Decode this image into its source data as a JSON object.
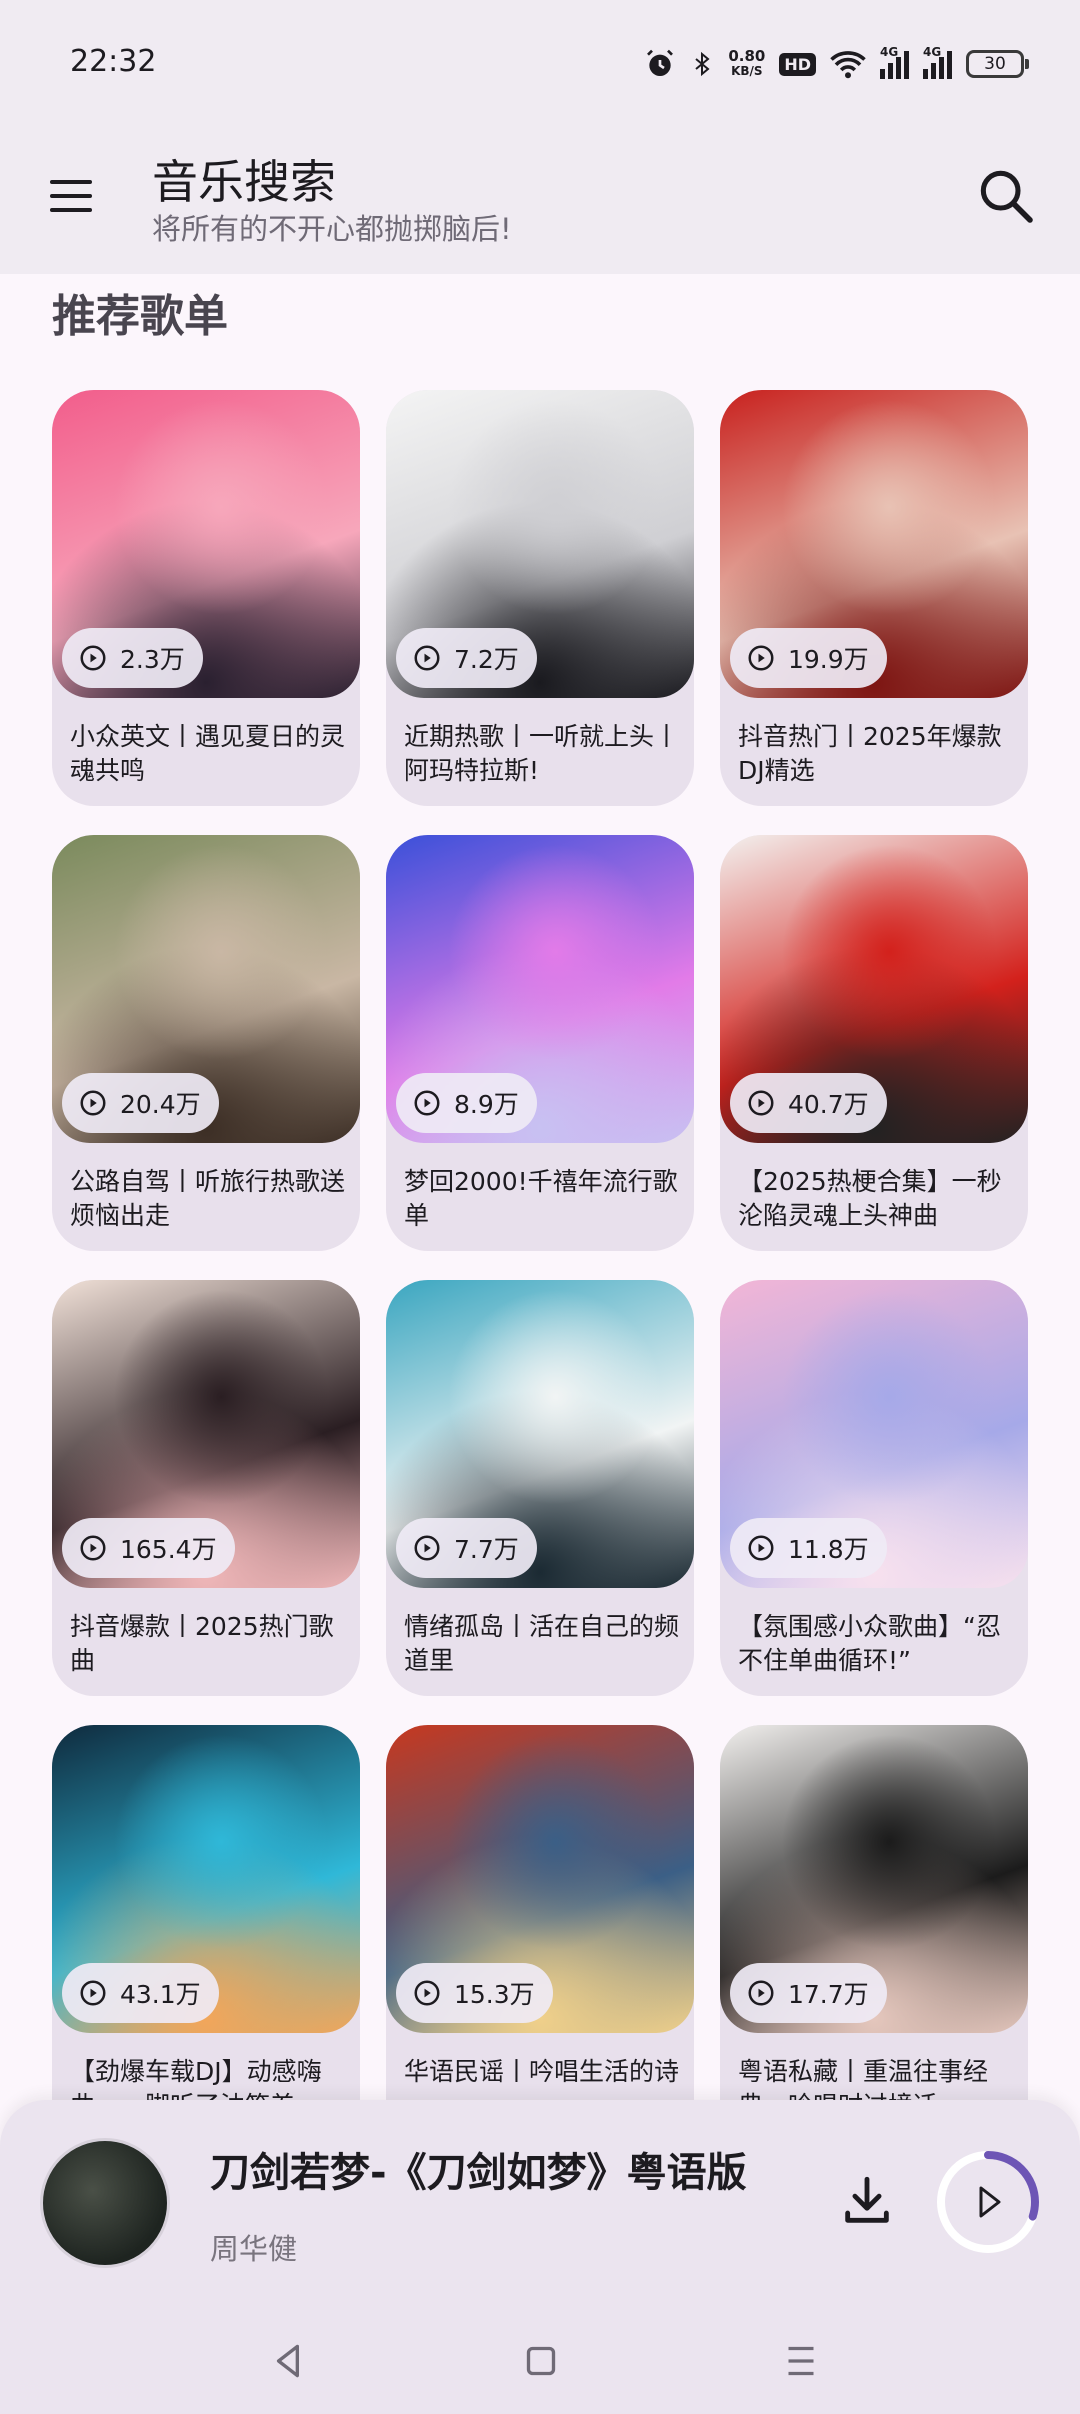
{
  "status_bar": {
    "time": "22:32",
    "net_speed": "0.80",
    "net_unit": "KB/S",
    "hd": "HD",
    "signal_1": "4G",
    "signal_2": "4G",
    "battery": "30",
    "icons": [
      "alarm-icon",
      "bluetooth-icon",
      "wifi-icon",
      "cell-signal-icon",
      "cell-signal-icon",
      "battery-icon"
    ]
  },
  "app_bar": {
    "title": "音乐搜索",
    "subtitle": "将所有的不开心都抛掷脑后!",
    "menu_icon": "menu-icon",
    "search_icon": "search-icon"
  },
  "section": {
    "title": "推荐歌单"
  },
  "playlists": [
    {
      "title": "小众英文丨遇见夏日的灵魂共鸣",
      "plays": "2.3万",
      "colors": [
        "#f25d8b",
        "#f7a7bb",
        "#2a2030"
      ]
    },
    {
      "title": "近期热歌丨一听就上头丨阿玛特拉斯!",
      "plays": "7.2万",
      "colors": [
        "#f4f4f4",
        "#cfcfd3",
        "#1a1a1f"
      ]
    },
    {
      "title": "抖音热门丨2025年爆款DJ精选",
      "plays": "19.9万",
      "colors": [
        "#c8211e",
        "#e8c2b4",
        "#7d1512"
      ]
    },
    {
      "title": "公路自驾丨听旅行热歌送烦恼出走",
      "plays": "20.4万",
      "colors": [
        "#7a8a5c",
        "#c9b7a4",
        "#3c2e25"
      ]
    },
    {
      "title": "梦回2000!千禧年流行歌单",
      "plays": "8.9万",
      "colors": [
        "#3a50d9",
        "#e27be8",
        "#c8c1f2"
      ]
    },
    {
      "title": "【2025热梗合集】一秒沦陷灵魂上头神曲",
      "plays": "40.7万",
      "colors": [
        "#f3f1ef",
        "#d3211c",
        "#222222"
      ]
    },
    {
      "title": "抖音爆款丨2025热门歌曲",
      "plays": "165.4万",
      "colors": [
        "#f1e1d8",
        "#2a1e22",
        "#f0b7b9"
      ]
    },
    {
      "title": "情绪孤岛丨活在自己的频道里",
      "plays": "7.7万",
      "colors": [
        "#3aa6c0",
        "#f1f4f4",
        "#1b2a33"
      ]
    },
    {
      "title": "【氛围感小众歌曲】“忍不住单曲循环!”",
      "plays": "11.8万",
      "colors": [
        "#f3b6d6",
        "#a6a9e8",
        "#f7e1ee"
      ]
    },
    {
      "title": "【劲爆车载DJ】动感嗨曲，一脚听了油箱差",
      "plays": "43.1万",
      "colors": [
        "#0f2a3d",
        "#2fb8d8",
        "#f2a65a"
      ]
    },
    {
      "title": "华语民谣丨吟唱生活的诗",
      "plays": "15.3万",
      "colors": [
        "#c7381f",
        "#3b5f86",
        "#f0d08a"
      ]
    },
    {
      "title": "粤语私藏丨重温往事经典，吟唱时过境迁",
      "plays": "17.7万",
      "colors": [
        "#f2f0ee",
        "#1b1b1b",
        "#e5c7bd"
      ]
    }
  ],
  "now_playing": {
    "title": "刀剑若梦-《刀剑如梦》粤语版",
    "artist": "周华健",
    "progress": 0.3,
    "download_icon": "download-icon",
    "play_icon": "play-icon"
  },
  "nav": {
    "icons": [
      "back-icon",
      "home-icon",
      "recents-icon"
    ]
  },
  "colors": {
    "accent": "#6d55b5",
    "card_bg": "#e8e0ec",
    "appbar_bg": "#f0ebf2"
  }
}
